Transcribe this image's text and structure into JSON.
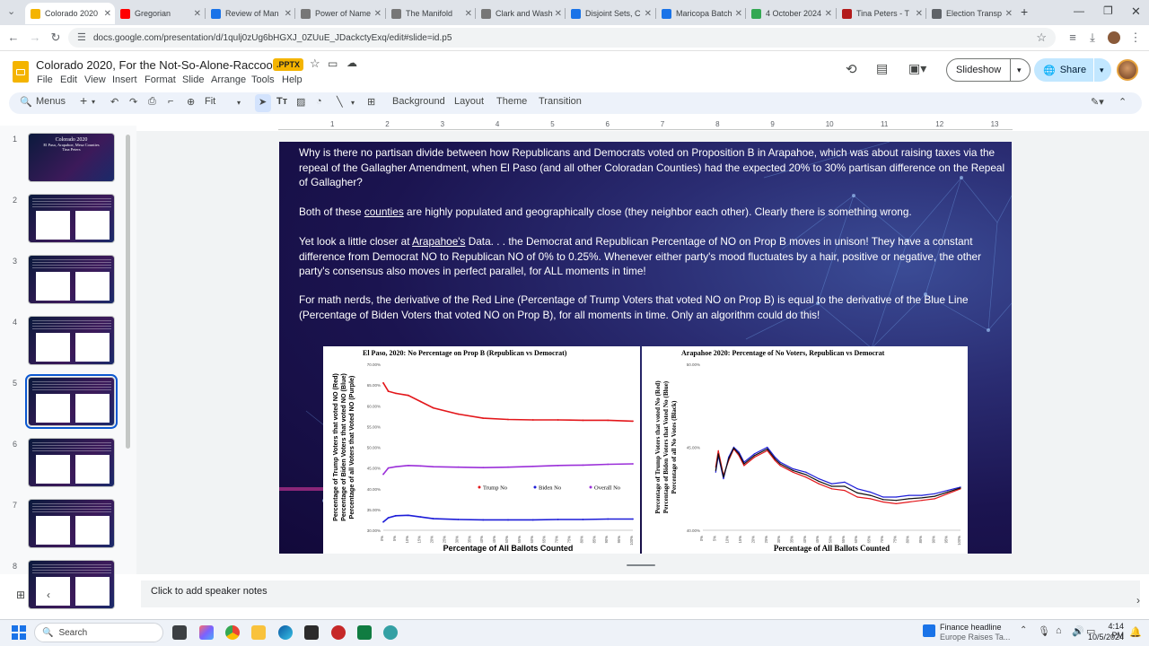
{
  "browser": {
    "tabs": [
      {
        "title": "Colorado 2020",
        "color": "#f4b400",
        "active": true
      },
      {
        "title": "Gregorian",
        "color": "#ff0000"
      },
      {
        "title": "Review of Man",
        "color": "#1a73e8"
      },
      {
        "title": "Power of Name",
        "color": "#777777"
      },
      {
        "title": "The Manifold",
        "color": "#777777"
      },
      {
        "title": "Clark and Wash",
        "color": "#777777"
      },
      {
        "title": "Disjoint Sets, C",
        "color": "#1a73e8"
      },
      {
        "title": "Maricopa Batch",
        "color": "#1a73e8"
      },
      {
        "title": "4 October 2024",
        "color": "#34a853"
      },
      {
        "title": "Tina Peters - T",
        "color": "#b31b1b"
      },
      {
        "title": "Election Transp",
        "color": "#5f6368"
      }
    ],
    "url": "docs.google.com/presentation/d/1qulj0zUg6bHGXJ_0ZUuE_JDackctyExq/edit#slide=id.p5"
  },
  "doc": {
    "title": "Colorado 2020, For the Not-So-Alone-Raccoon",
    "badge": ".PPTX",
    "menus": [
      "File",
      "Edit",
      "View",
      "Insert",
      "Format",
      "Slide",
      "Arrange",
      "Tools",
      "Help"
    ],
    "slideshow": "Slideshow",
    "share": "Share"
  },
  "toolbar": {
    "search": "Menus",
    "zoom": "Fit",
    "background": "Background",
    "layout": "Layout",
    "theme": "Theme",
    "transition": "Transition"
  },
  "ruler": [
    "1",
    "2",
    "3",
    "4",
    "5",
    "6",
    "7",
    "8",
    "9",
    "10",
    "11",
    "12",
    "13"
  ],
  "thumbs": [
    {
      "num": "1",
      "line1": "Colorado 2020",
      "line2": "El Paso, Arapahoe, Mesa Counties",
      "line3": "Tina Peters"
    },
    {
      "num": "2"
    },
    {
      "num": "3"
    },
    {
      "num": "4"
    },
    {
      "num": "5"
    },
    {
      "num": "6"
    },
    {
      "num": "7"
    },
    {
      "num": "8"
    }
  ],
  "slide": {
    "p1": "Why is there no partisan divide between how Republicans and Democrats voted on Proposition B in Arapahoe, which was about raising taxes via the repeal of the Gallagher Amendment, when El Paso (and all other Coloradan Counties) had the expected 20% to 30% partisan difference on the Repeal of Gallagher?",
    "p2a": "Both of these ",
    "p2b": "counties",
    "p2c": " are highly populated and geographically close (they neighbor each other). Clearly there is something wrong.",
    "p3a": "Yet look a little closer at ",
    "p3b": "Arapahoe's",
    "p3c": " Data. . . the Democrat and Republican Percentage of NO on Prop B moves in unison! They have a constant difference from Democrat NO to Republican NO of 0% to 0.25%. Whenever either party's mood fluctuates by a hair, positive or negative, the other party's consensus also moves in perfect parallel, for ALL moments in time!",
    "p4": "For math nerds, the derivative of the Red Line (Percentage of Trump Voters that voted NO on Prop B) is equal to the derivative of the Blue Line (Percentage of Biden Voters that voted NO on Prop B), for all moments in time. Only an algorithm could do this!"
  },
  "chart_data": [
    {
      "type": "line",
      "title": "El Paso, 2020: No Percentage on Prop B (Republican vs Democrat)",
      "xlabel": "Percentage of All Ballots Counted",
      "ylabel": "Percentage of Trump Voters that voted NO (Red) Percentage of Biden Voters that voted NO (Blue) Percentage of all Voters that Voted NO (Purple)",
      "ylim": [
        30,
        70
      ],
      "yticks": [
        "70.00%",
        "65.00%",
        "60.00%",
        "55.00%",
        "50.00%",
        "45.00%",
        "40.00%",
        "35.00%",
        "30.00%"
      ],
      "xticks": [
        "0%",
        "5%",
        "10%",
        "15%",
        "20%",
        "25%",
        "30%",
        "35%",
        "40%",
        "45%",
        "50%",
        "55%",
        "60%",
        "65%",
        "70%",
        "75%",
        "80%",
        "85%",
        "90%",
        "95%",
        "100%"
      ],
      "x": [
        0,
        2,
        5,
        10,
        15,
        20,
        30,
        40,
        50,
        60,
        70,
        80,
        90,
        100
      ],
      "series": [
        {
          "name": "Trump No",
          "color": "#e3161a",
          "values": [
            65.5,
            63.5,
            63,
            62.5,
            61,
            59.5,
            58,
            57,
            56.7,
            56.6,
            56.6,
            56.5,
            56.5,
            56.3
          ]
        },
        {
          "name": "Biden No",
          "color": "#1c1cd8",
          "values": [
            32,
            33,
            33.5,
            33.6,
            33.2,
            32.8,
            32.6,
            32.5,
            32.5,
            32.5,
            32.6,
            32.6,
            32.7,
            32.7
          ]
        },
        {
          "name": "Overall No",
          "color": "#9b30d9",
          "values": [
            43.5,
            45,
            45.3,
            45.6,
            45.5,
            45.3,
            45.2,
            45.1,
            45.2,
            45.4,
            45.6,
            45.7,
            45.9,
            46
          ]
        }
      ],
      "legend": "center-right"
    },
    {
      "type": "line",
      "title": "Arapahoe 2020: Percentage of No Voters, Republican vs Democrat",
      "xlabel": "Percentage of All Ballots Counted",
      "ylabel": "Percentage of Trump Voters that voted No (Red) Percentage of Biden Voters that Voted No (Blue) Percentage of all No Votes (Black)",
      "ylim": [
        40,
        50
      ],
      "yticks": [
        "50.00%",
        "45.00%",
        "40.00%"
      ],
      "xticks": [
        "0%",
        "5%",
        "10%",
        "15%",
        "20%",
        "25%",
        "30%",
        "35%",
        "40%",
        "45%",
        "50%",
        "55%",
        "60%",
        "65%",
        "70%",
        "75%",
        "80%",
        "85%",
        "90%",
        "95%",
        "100%"
      ],
      "x": [
        5,
        6,
        8,
        10,
        12,
        14,
        16,
        20,
        25,
        28,
        30,
        35,
        40,
        45,
        50,
        55,
        60,
        65,
        70,
        75,
        80,
        85,
        90,
        95,
        100
      ],
      "series": [
        {
          "name": "Red",
          "color": "#e3161a",
          "values": [
            43.8,
            44.8,
            43.3,
            44.2,
            44.9,
            44.5,
            43.9,
            44.4,
            44.8,
            44.2,
            43.9,
            43.5,
            43.2,
            42.8,
            42.5,
            42.4,
            42,
            41.9,
            41.7,
            41.6,
            41.7,
            41.8,
            41.9,
            42.2,
            42.5
          ]
        },
        {
          "name": "Blue",
          "color": "#1c1cd8",
          "values": [
            43.5,
            44.5,
            43.1,
            44.4,
            45,
            44.7,
            44.1,
            44.6,
            45,
            44.4,
            44.1,
            43.7,
            43.5,
            43.1,
            42.8,
            42.9,
            42.5,
            42.3,
            42,
            42,
            42.1,
            42.1,
            42.2,
            42.4,
            42.6
          ]
        },
        {
          "name": "Black",
          "color": "#111111",
          "values": [
            43.6,
            44.6,
            43.2,
            44.3,
            44.95,
            44.6,
            44,
            44.5,
            44.9,
            44.3,
            44,
            43.6,
            43.35,
            42.95,
            42.65,
            42.65,
            42.25,
            42.1,
            41.85,
            41.8,
            41.9,
            41.95,
            42.05,
            42.3,
            42.55
          ]
        }
      ]
    }
  ],
  "notes": {
    "placeholder": "Click to add speaker notes"
  },
  "taskbar": {
    "search": "Search",
    "news_title": "Finance headline",
    "news_sub": "Europe Raises Ta...",
    "time": "4:14 PM",
    "date": "10/5/2024"
  }
}
